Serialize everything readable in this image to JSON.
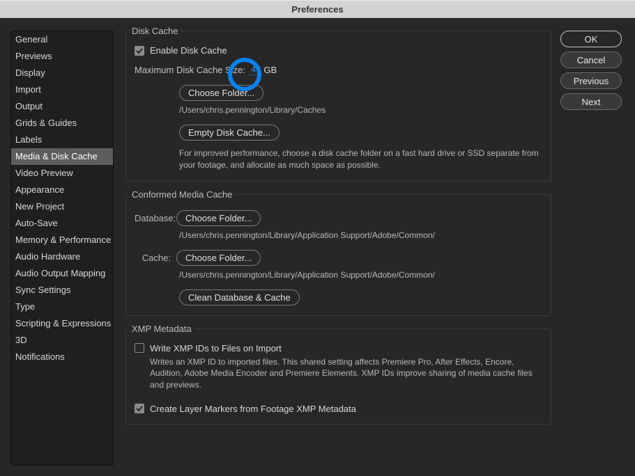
{
  "window": {
    "title": "Preferences"
  },
  "buttons": {
    "ok": "OK",
    "cancel": "Cancel",
    "previous": "Previous",
    "next": "Next"
  },
  "sidebar": {
    "items": [
      "General",
      "Previews",
      "Display",
      "Import",
      "Output",
      "Grids & Guides",
      "Labels",
      "Media & Disk Cache",
      "Video Preview",
      "Appearance",
      "New Project",
      "Auto-Save",
      "Memory & Performance",
      "Audio Hardware",
      "Audio Output Mapping",
      "Sync Settings",
      "Type",
      "Scripting & Expressions",
      "3D",
      "Notifications"
    ],
    "selected_index": 7
  },
  "disk_cache": {
    "section_title": "Disk Cache",
    "enable_label": "Enable Disk Cache",
    "enabled": true,
    "max_size_label": "Maximum Disk Cache Size:",
    "max_size_value": "46",
    "max_size_unit": "GB",
    "choose_folder": "Choose Folder...",
    "folder_path": "/Users/chris.pennington/Library/Caches",
    "empty_button": "Empty Disk Cache...",
    "hint": "For improved performance, choose a disk cache folder on a fast hard drive or SSD separate from your footage, and allocate as much space as possible."
  },
  "conformed": {
    "section_title": "Conformed Media Cache",
    "database_label": "Database:",
    "cache_label": "Cache:",
    "choose_folder": "Choose Folder...",
    "database_path": "/Users/chris.pennington/Library/Application Support/Adobe/Common/",
    "cache_path": "/Users/chris.pennington/Library/Application Support/Adobe/Common/",
    "clean_button": "Clean Database & Cache"
  },
  "xmp": {
    "section_title": "XMP Metadata",
    "write_ids_label": "Write XMP IDs to Files on Import",
    "write_ids_checked": false,
    "write_ids_desc": "Writes an XMP ID to imported files. This shared setting affects Premiere Pro, After Effects, Encore, Audition, Adobe Media Encoder and Premiere Elements. XMP IDs improve sharing of media cache files and previews.",
    "layer_markers_label": "Create Layer Markers from Footage XMP Metadata",
    "layer_markers_checked": true
  }
}
